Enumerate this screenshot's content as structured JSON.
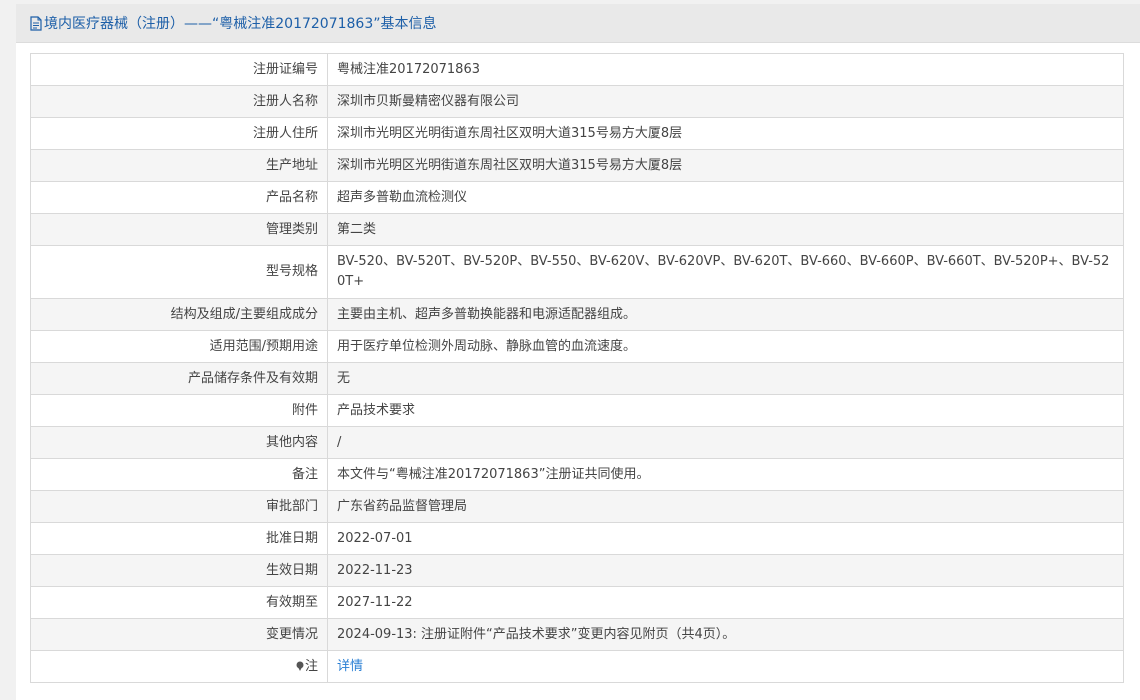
{
  "header": {
    "title": "境内医疗器械（注册）——“粤械注准20172071863”基本信息"
  },
  "rows": [
    {
      "label": "注册证编号",
      "value": "粤械注准20172071863"
    },
    {
      "label": "注册人名称",
      "value": "深圳市贝斯曼精密仪器有限公司"
    },
    {
      "label": "注册人住所",
      "value": "深圳市光明区光明街道东周社区双明大道315号易方大厦8层"
    },
    {
      "label": "生产地址",
      "value": "深圳市光明区光明街道东周社区双明大道315号易方大厦8层"
    },
    {
      "label": "产品名称",
      "value": "超声多普勒血流检测仪"
    },
    {
      "label": "管理类别",
      "value": "第二类"
    },
    {
      "label": "型号规格",
      "value": "BV-520、BV-520T、BV-520P、BV-550、BV-620V、BV-620VP、BV-620T、BV-660、BV-660P、BV-660T、BV-520P+、BV-520T+"
    },
    {
      "label": "结构及组成/主要组成成分",
      "value": "主要由主机、超声多普勒换能器和电源适配器组成。"
    },
    {
      "label": "适用范围/预期用途",
      "value": "用于医疗单位检测外周动脉、静脉血管的血流速度。"
    },
    {
      "label": "产品储存条件及有效期",
      "value": "无"
    },
    {
      "label": "附件",
      "value": "产品技术要求"
    },
    {
      "label": "其他内容",
      "value": "/"
    },
    {
      "label": "备注",
      "value": "本文件与“粤械注准20172071863”注册证共同使用。"
    },
    {
      "label": "审批部门",
      "value": "广东省药品监督管理局"
    },
    {
      "label": "批准日期",
      "value": "2022-07-01"
    },
    {
      "label": "生效日期",
      "value": "2022-11-23"
    },
    {
      "label": "有效期至",
      "value": "2027-11-22"
    },
    {
      "label": "变更情况",
      "value": "2024-09-13: 注册证附件“产品技术要求”变更内容见附页（共4页）。"
    }
  ],
  "note_row": {
    "label": "注",
    "link_text": "详情"
  },
  "colors": {
    "header_text": "#1d5fa8",
    "link": "#2a7fd4"
  },
  "icons": {
    "header": "document-icon",
    "note": "pin-icon"
  }
}
